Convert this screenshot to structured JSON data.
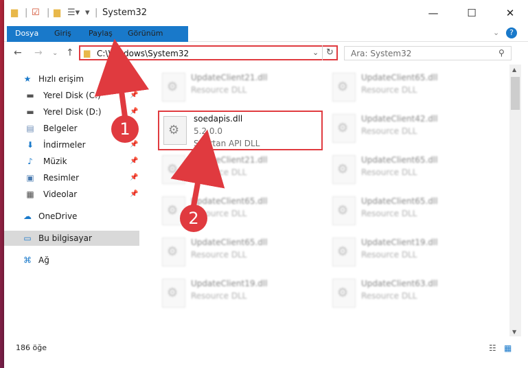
{
  "window": {
    "title": "System32",
    "ribbon_tabs": [
      "Dosya",
      "Giriş",
      "Paylaş",
      "Görünüm"
    ]
  },
  "address": {
    "path": "C:\\Windows\\System32",
    "search_placeholder": "Ara: System32"
  },
  "sidebar": {
    "items": [
      {
        "label": "Hızlı erişim",
        "icon": "star-icon"
      },
      {
        "label": "Yerel Disk (C:)",
        "icon": "drive-icon",
        "pinned": true
      },
      {
        "label": "Yerel Disk (D:)",
        "icon": "drive-icon",
        "pinned": true
      },
      {
        "label": "Belgeler",
        "icon": "documents-icon",
        "pinned": true
      },
      {
        "label": "İndirmeler",
        "icon": "download-icon",
        "pinned": true
      },
      {
        "label": "Müzik",
        "icon": "music-icon",
        "pinned": true
      },
      {
        "label": "Resimler",
        "icon": "pictures-icon",
        "pinned": true
      },
      {
        "label": "Videolar",
        "icon": "video-icon",
        "pinned": true
      },
      {
        "label": "OneDrive",
        "icon": "cloud-icon"
      },
      {
        "label": "Bu bilgisayar",
        "icon": "computer-icon",
        "selected": true
      },
      {
        "label": "Ağ",
        "icon": "network-icon"
      }
    ]
  },
  "files": {
    "left_column": [
      {
        "name": "UpdateClient21.dll",
        "type": "Resource DLL"
      },
      {
        "name": "UpdateClient21.dll",
        "type": "Resource DLL"
      },
      {
        "name": "UpdateClient65.dll",
        "type": "Resource DLL"
      },
      {
        "name": "UpdateClient65.dll",
        "type": "Resource DLL"
      },
      {
        "name": "UpdateClient19.dll",
        "type": "Resource DLL"
      }
    ],
    "right_column": [
      {
        "name": "UpdateClient65.dll",
        "type": "Resource DLL"
      },
      {
        "name": "UpdateClient42.dll",
        "type": "Resource DLL"
      },
      {
        "name": "UpdateClient65.dll",
        "type": "Resource DLL"
      },
      {
        "name": "UpdateClient65.dll",
        "type": "Resource DLL"
      },
      {
        "name": "UpdateClient19.dll",
        "type": "Resource DLL"
      },
      {
        "name": "UpdateClient63.dll",
        "type": "Resource DLL"
      }
    ],
    "highlighted": {
      "name": "soedapis.dll",
      "version": "5.2.0.0",
      "type": "Spartan API DLL"
    }
  },
  "status": {
    "item_count": "186 öğe"
  },
  "annotations": {
    "step1": "1",
    "step2": "2",
    "color": "#e03a3f"
  }
}
